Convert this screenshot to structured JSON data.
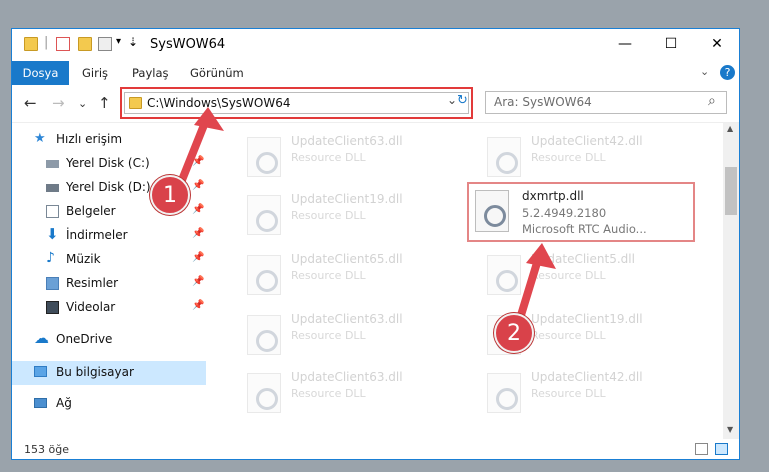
{
  "window": {
    "title": "SysWOW64",
    "controls": {
      "minimize": "—",
      "maximize": "☐",
      "close": "✕"
    }
  },
  "ribbon": {
    "tabs": [
      "Dosya",
      "Giriş",
      "Paylaş",
      "Görünüm"
    ],
    "help": "?",
    "expand": "⌄"
  },
  "nav": {
    "back": "←",
    "forward": "→",
    "recent": "⌄",
    "up": "↑",
    "address": "C:\\Windows\\SysWOW64",
    "dropdown": "⌄",
    "refresh": "↻",
    "search_placeholder": "Ara: SysWOW64",
    "search_icon": "⌕"
  },
  "sidebar": {
    "items": [
      {
        "label": "Hızlı erişim",
        "icon": "star-icon"
      },
      {
        "label": "Yerel Disk (C:)",
        "icon": "drive-icon",
        "pinned": true
      },
      {
        "label": "Yerel Disk (D:)",
        "icon": "drive-icon",
        "pinned": true
      },
      {
        "label": "Belgeler",
        "icon": "document-icon",
        "pinned": true
      },
      {
        "label": "İndirmeler",
        "icon": "download-icon",
        "pinned": true
      },
      {
        "label": "Müzik",
        "icon": "music-icon",
        "pinned": true
      },
      {
        "label": "Resimler",
        "icon": "pictures-icon",
        "pinned": true
      },
      {
        "label": "Videolar",
        "icon": "video-icon",
        "pinned": true
      },
      {
        "label": "OneDrive",
        "icon": "cloud-icon"
      },
      {
        "label": "Bu bilgisayar",
        "icon": "computer-icon"
      },
      {
        "label": "Ağ",
        "icon": "network-icon"
      }
    ],
    "pin_glyph": "📌"
  },
  "files": [
    {
      "name": "UpdateClient63.dll",
      "type": "Resource DLL"
    },
    {
      "name": "UpdateClient42.dll",
      "type": "Resource DLL"
    },
    {
      "name": "UpdateClient19.dll",
      "type": "Resource DLL"
    },
    {
      "name": "UpdateClient65.dll",
      "type": "Resource DLL"
    },
    {
      "name": "UpdateClient5.dll",
      "type": "Resource DLL"
    },
    {
      "name": "UpdateClient63.dll",
      "type": "Resource DLL"
    },
    {
      "name": "UpdateClient19.dll",
      "type": "Resource DLL"
    },
    {
      "name": "UpdateClient63.dll",
      "type": "Resource DLL"
    },
    {
      "name": "UpdateClient42.dll",
      "type": "Resource DLL"
    }
  ],
  "highlighted_file": {
    "name": "dxmrtp.dll",
    "version": "5.2.4949.2180",
    "description": "Microsoft RTC Audio..."
  },
  "markers": [
    "1",
    "2"
  ],
  "status": {
    "count": "153 öğe"
  },
  "colors": {
    "accent": "#1979ca",
    "highlight": "#e23a3a",
    "marker": "#d9424a"
  }
}
